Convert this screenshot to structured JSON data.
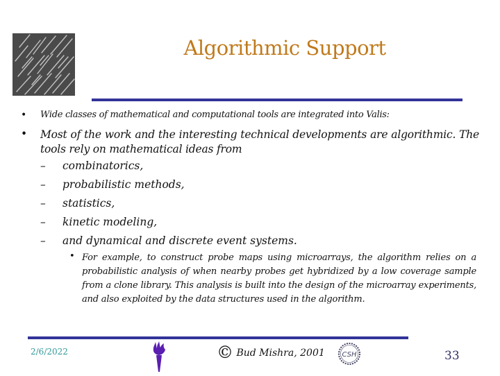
{
  "slide": {
    "title": "Algorithmic Support",
    "bullets": [
      {
        "text": "Wide classes of mathematical and computational tools are integrated into Valis:"
      },
      {
        "text": "Most of the work and the interesting technical developments are algorithmic.  The tools rely on mathematical ideas from"
      }
    ],
    "sub_items": [
      "combinatorics,",
      "probabilistic methods,",
      "statistics,",
      "kinetic modeling,",
      "and dynamical and discrete event systems."
    ],
    "example": "For example, to construct probe maps using microarrays, the algorithm relies on a probabilistic analysis of when nearby probes get hybridized by a low coverage sample from a clone library.  This analysis is built into the design of the microarray experiments, and also exploited by the data structures used in the algorithm.",
    "bullet_glyph": "•",
    "dash_glyph": "–"
  },
  "footer": {
    "date": "2/6/2022",
    "copyright_symbol": "©",
    "copyright_text": "Bud Mishra, 2001",
    "csh_label": "CSH",
    "page_number": "33"
  },
  "colors": {
    "title": "#c07a1c",
    "rule": "#333399",
    "date": "#339999",
    "torch": "#5a1fb0"
  }
}
